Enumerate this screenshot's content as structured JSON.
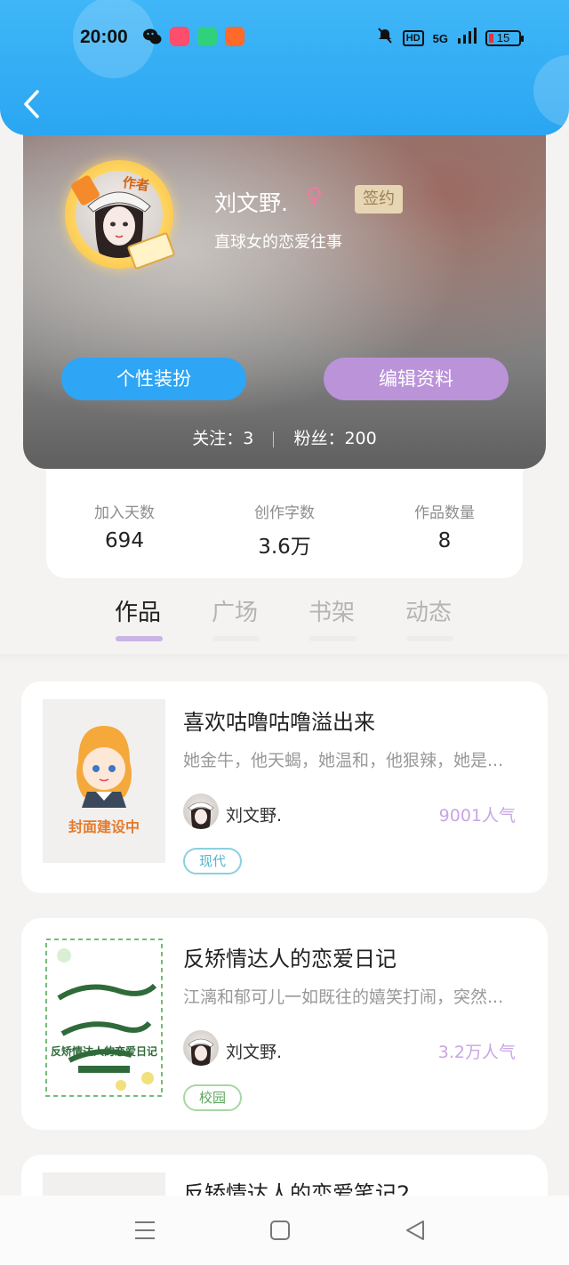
{
  "status_bar": {
    "time": "20:00",
    "network": "5G",
    "hd": "HD",
    "battery": "15"
  },
  "profile": {
    "name": "刘文野.",
    "gender_symbol": "♀",
    "signed_badge": "签约",
    "author_tag": "作者",
    "motto": "直球女的恋爱往事",
    "dress_button": "个性装扮",
    "edit_button": "编辑资料",
    "follow_label": "关注：3",
    "fans_label": "粉丝：200"
  },
  "stats": [
    {
      "label": "加入天数",
      "value": "694"
    },
    {
      "label": "创作字数",
      "value": "3.6万"
    },
    {
      "label": "作品数量",
      "value": "8"
    }
  ],
  "tabs": [
    {
      "label": "作品",
      "active": true
    },
    {
      "label": "广场",
      "active": false
    },
    {
      "label": "书架",
      "active": false
    },
    {
      "label": "动态",
      "active": false
    }
  ],
  "books": [
    {
      "title": "喜欢咕噜咕噜溢出来",
      "desc": "她金牛，他天蝎，她温和，他狠辣，她是...",
      "author": "刘文野.",
      "popularity": "9001人气",
      "tag": "现代",
      "cover_text": "封面建设中"
    },
    {
      "title": "反矫情达人的恋爱日记",
      "desc": "江漓和郁可儿一如既往的嬉笑打闹，突然...",
      "author": "刘文野.",
      "popularity": "3.2万人气",
      "tag": "校园",
      "cover_text": "反矫情达人的恋爱日记"
    }
  ],
  "book3_partial_title": "反矫情达人的恋爱笔记2",
  "colors": {
    "header_blue": "#2aa6f2",
    "dress_button": "#2ea5f5",
    "edit_button": "#bb93d9",
    "popularity": "#c8a6e4",
    "tab_underline_active": "#c9b4e6"
  }
}
